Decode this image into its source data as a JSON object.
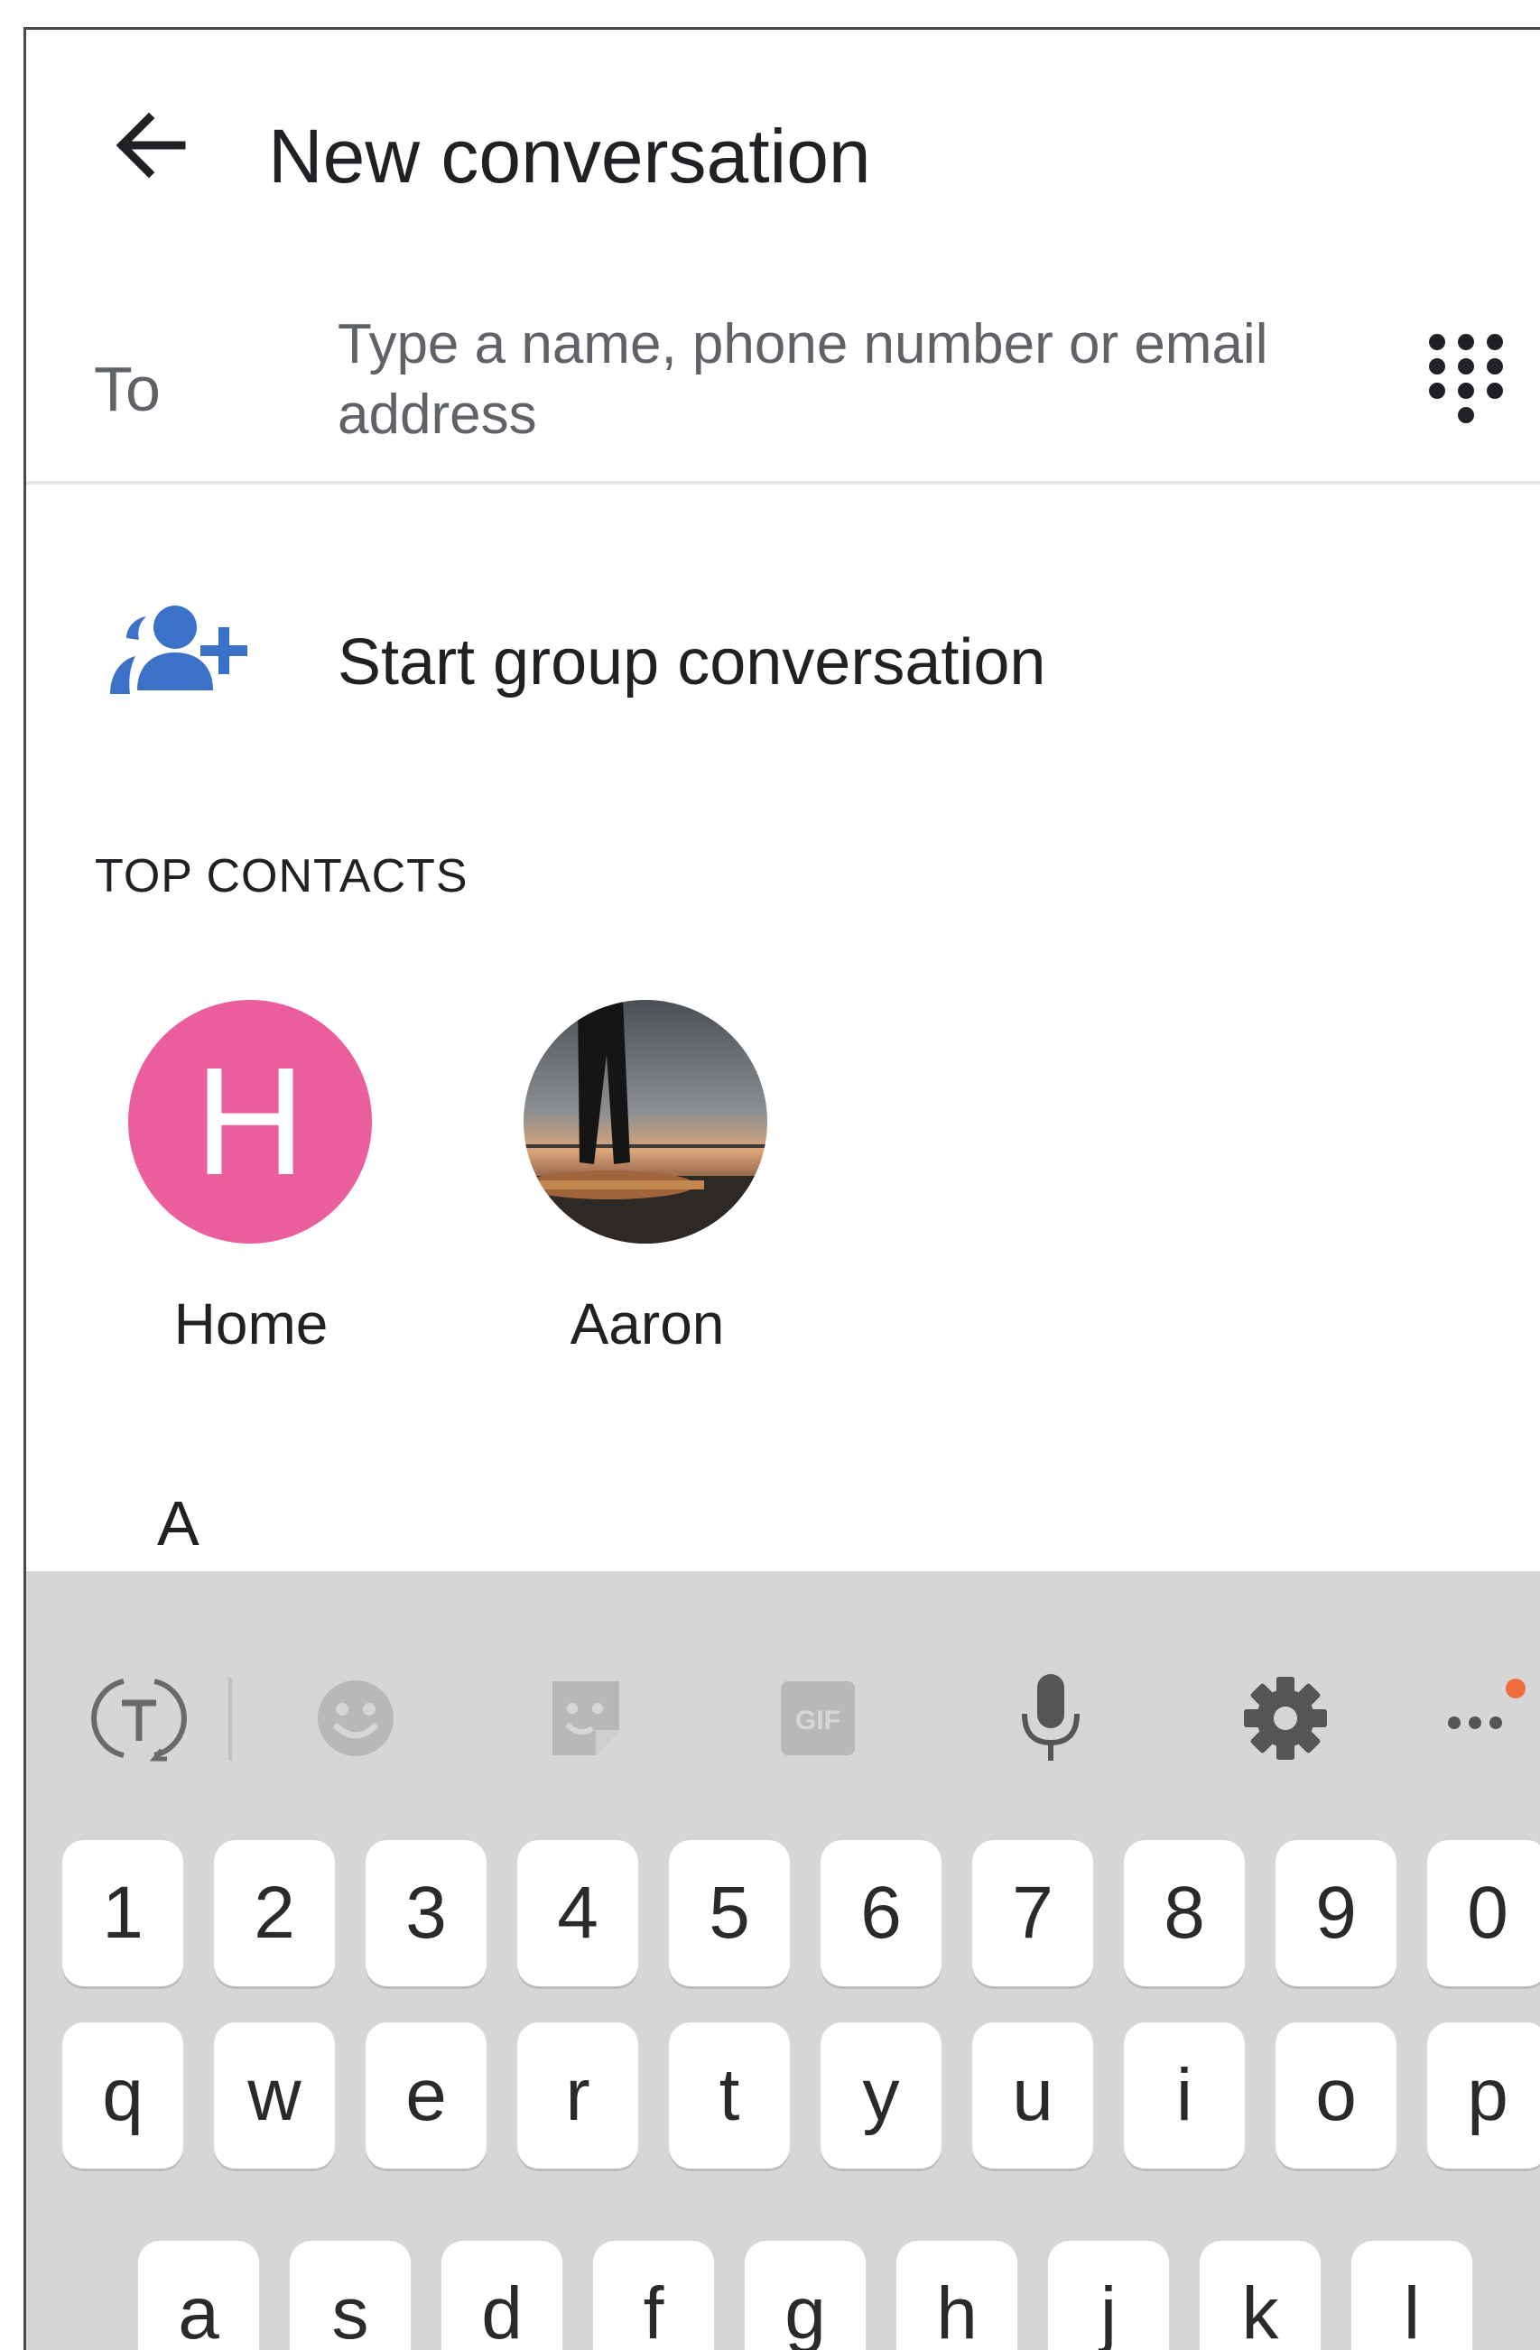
{
  "header": {
    "title": "New conversation",
    "back_icon": "arrow-back-icon"
  },
  "to_row": {
    "label": "To",
    "placeholder": "Type a name, phone number or email address",
    "dialpad_icon": "dialpad-icon"
  },
  "group": {
    "label": "Start group conversation",
    "icon": "group-add-icon",
    "icon_color": "#3b72c7"
  },
  "top_contacts": {
    "title": "TOP CONTACTS",
    "contacts": [
      {
        "name": "Home",
        "initial": "H",
        "color": "#ea5e9d"
      },
      {
        "name": "Aaron",
        "avatar": "photo"
      }
    ]
  },
  "index_letter": "A",
  "keyboard": {
    "toolbar_icons": [
      "text-translate-icon",
      "emoji-icon",
      "sticker-icon",
      "gif-icon",
      "mic-icon",
      "settings-icon",
      "more-icon"
    ],
    "gif_label": "GIF",
    "number_row": [
      "1",
      "2",
      "3",
      "4",
      "5",
      "6",
      "7",
      "8",
      "9",
      "0"
    ],
    "row1": [
      "q",
      "w",
      "e",
      "r",
      "t",
      "y",
      "u",
      "i",
      "o",
      "p"
    ],
    "row2": [
      "a",
      "s",
      "d",
      "f",
      "g",
      "h",
      "j",
      "k",
      "l"
    ]
  }
}
